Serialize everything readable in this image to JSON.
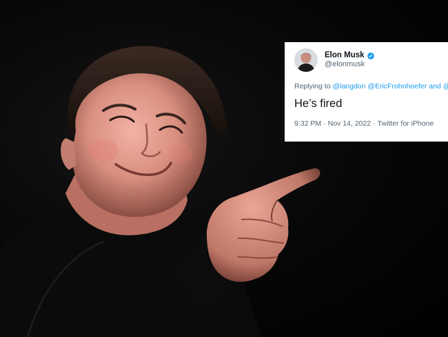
{
  "tweet": {
    "display_name": "Elon Musk",
    "handle": "@elonmusk",
    "reply_prefix": "Replying to",
    "reply_mentions": [
      "@langdon",
      "@EricFrohnhoefer",
      "and @"
    ],
    "text": "He’s fired",
    "time": "9:32 PM",
    "separator": "·",
    "date": "Nov 14, 2022",
    "source": "Twitter for iPhone",
    "icons": {
      "verified": "verified-badge-icon",
      "avatar": "profile-avatar"
    },
    "colors": {
      "link": "#1d9bf0",
      "verified": "#1d9bf0",
      "text": "#0f1419",
      "secondary": "#536471",
      "card": "#ffffff"
    }
  }
}
